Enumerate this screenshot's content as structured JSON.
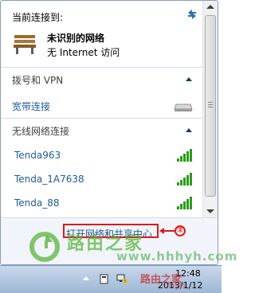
{
  "panel": {
    "connected_title": "当前连接到:",
    "network": {
      "name": "未识别的网络",
      "status": "无 Internet 访问"
    },
    "dialup_section": {
      "label": "拨号和 VPN",
      "items": [
        {
          "label": "宽带连接"
        }
      ]
    },
    "wireless_section": {
      "label": "无线网络连接",
      "networks": [
        {
          "name": "Tenda963",
          "signal": "full"
        },
        {
          "name": "Tenda_1A7638",
          "signal": "full"
        },
        {
          "name": "Tenda_88",
          "signal": "full"
        }
      ]
    },
    "footer": {
      "open_center_link": "打开网络和共享中心",
      "callout_number": "②"
    }
  },
  "watermark": {
    "brand": "路由之家",
    "url": "www.hhhyh.com"
  },
  "taskbar": {
    "clock_time": "12:48",
    "clock_date": "2013/1/12",
    "stamp_text": "路由之家",
    "stamp_sub": "hyh"
  },
  "colors": {
    "link": "#1e5a96",
    "callout_red": "#e01818",
    "signal_green": "#2e9a1e"
  }
}
